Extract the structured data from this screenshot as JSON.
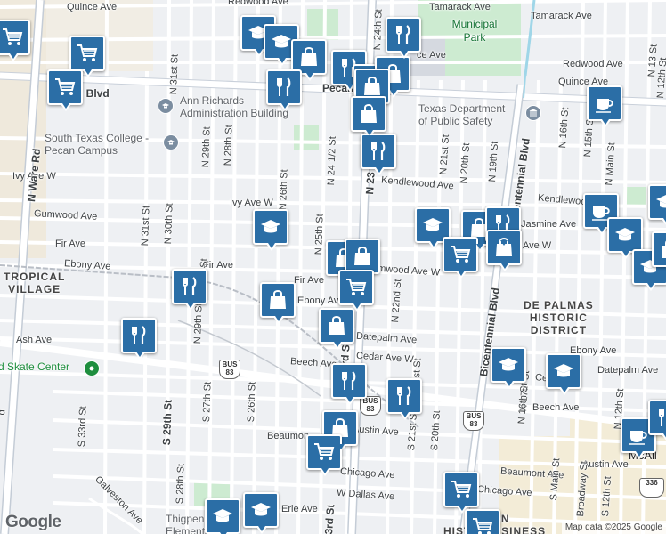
{
  "map": {
    "attribution": "Map data ©2025 Google",
    "logo": "Google",
    "parks": [
      {
        "name": "Municipal\nPark",
        "label": "Municipal Park"
      }
    ],
    "pois": [
      {
        "name": "Ann Richards Administration Building",
        "line1": "Ann Richards",
        "line2": "Administration Building",
        "icon": "school-icon"
      },
      {
        "name": "South Texas College - Pecan Campus",
        "line1": "South Texas College -",
        "line2": "Pecan Campus",
        "icon": "school-icon"
      },
      {
        "name": "Texas Department of Public Safety",
        "line1": "Texas Department",
        "line2": "of Public Safety",
        "icon": "government-icon"
      },
      {
        "name": "Skate Center",
        "line1": "d Skate Center",
        "line2": "",
        "icon": "park-icon"
      },
      {
        "name": "Thigpen Elementary",
        "line1": "Thigpen",
        "line2": "Elementary",
        "icon": "school-icon"
      }
    ],
    "districts": [
      {
        "line1": "TROPICAL",
        "line2": "VILLAGE"
      },
      {
        "line1": "DE PALMAS",
        "line2": "HISTORIC",
        "line3": "DISTRICT"
      },
      {
        "line1": "M   EN",
        "line2": "HISTO   BUSINESS"
      }
    ],
    "city_label": "McAll",
    "streets": {
      "quince_ave": "Quince Ave",
      "redwood_ave": "Redwood Ave",
      "tamarack_ave": "Tamarack Ave",
      "tamarack_ave_e": "Tamarack Ave",
      "redwood_ave_e": "Redwood Ave",
      "quince_ave_e": "Quince Ave",
      "pecan_blvd": "Pecan",
      "pecan_blvd_w": "n Blvd",
      "ivy_ave_w": "Ivy Ave W",
      "kendlewood_ave": "Kendlewood Ave",
      "kendlewood_ave_e": "Kendlewood Ave",
      "gumwood_ave": "Gumwood Ave",
      "jasmine_ave": "Jasmine Ave",
      "fir_ave": "Fir Ave",
      "fir_ave_2": "Fir Ave",
      "fir_ave_3": "Fir Ave",
      "ebony_ave": "Ebony Ave",
      "ebony_ave_2": "Ebony Av",
      "ebony_ave_e": "Ebony Ave",
      "gamwood_ave_w": "amwood Ave W",
      "ave_w": "Ave W",
      "ash_ave": "Ash Ave",
      "datepalm_ave": "Datepalm Ave",
      "datepalm_ave_e": "Datepalm Ave",
      "cedar_ave_w": "Cedar Ave W",
      "cedar_ave_e": "Ce    Ave W",
      "beech_ave": "Beech Ave",
      "beech_ave_e": "Beech Ave",
      "austin_ave": "Austin Ave",
      "austin_ave_e": "Austin Ave",
      "beaumont_ave": "Beaumont Ave",
      "beaumont_ave_w": "Beaumon",
      "chicago_ave": "Chicago Ave",
      "chicago_ave_e": "Chicago Ave",
      "w_dallas_ave": "W Dallas Ave",
      "erie_ave": "Erie Ave",
      "galveston_ave": "Galveston Ave",
      "n_ware_rd": "N Ware Rd",
      "n_31st_st": "N 31st St",
      "n_31st_st_2": "N 31st St",
      "n_30th_st": "N 30th St",
      "n_29th_st": "N 29th St",
      "n_28th_st": "N 28th St",
      "n_28th_st_2": "N 28th St",
      "n_29th_st_2": "N 29th St",
      "n_26th_st": "N 26th St",
      "n_25th_st": "N 25th St",
      "n_24_half_st": "N 24 1/2 St",
      "n_24th_st": "N 24th St",
      "n_23rd_st": "N 23",
      "n_22nd_st": "N 22nd St",
      "n_21st_st": "N 21st St",
      "n_20th_st": "N 20th St",
      "n_19th_st": "N 19th St",
      "n_17th_st": "N 17th St",
      "n_16th_st": "N 16th St",
      "n_16th_st_2": "N 16th St",
      "n_15th_st": "N 15th St",
      "n_13th_st": "N 13 St",
      "n_12th_st": "N 12th St",
      "n_12th_st_2": "N 12th St",
      "n_main_st": "N Main St",
      "bicentennial_blvd": "Bicentennial Blvd",
      "bicentennial_blvd_2": "Bicentennial Blvd",
      "s_29th_st": "S 29th St",
      "s_28th_st": "S 28th St",
      "s_27th_st": "S 27th St",
      "s_26th_st": "S 26th St",
      "s_33rd_st": "S 33rd St",
      "s_21st_st": "S 21st St",
      "s_20th_st": "S 20th St",
      "s_12th_st": "S 12th St",
      "s_main_st": "S Main St",
      "broadway_st": "Broadway St",
      "rd_st": "rd St",
      "rd_st_2": "3rd St",
      "rd_st_3": "3rd St",
      "st_22": "st St",
      "n_23rd_st_b": "N 23rd St"
    },
    "shields": [
      {
        "top": "BUS",
        "num": "83"
      },
      {
        "top": "BUS",
        "num": "83"
      },
      {
        "top": "BUS",
        "num": "83"
      },
      {
        "top": "",
        "num": "83"
      },
      {
        "top": "",
        "num": "336"
      }
    ],
    "markers": [
      {
        "type": "shopping-cart"
      },
      {
        "type": "shopping-cart"
      },
      {
        "type": "shopping-cart"
      },
      {
        "type": "school"
      },
      {
        "type": "school"
      },
      {
        "type": "shopping-bag"
      },
      {
        "type": "restaurant"
      },
      {
        "type": "restaurant"
      },
      {
        "type": "restaurant"
      },
      {
        "type": "shopping-bag"
      },
      {
        "type": "restaurant"
      },
      {
        "type": "shopping-bag"
      },
      {
        "type": "shopping-bag"
      },
      {
        "type": "restaurant"
      },
      {
        "type": "cafe"
      },
      {
        "type": "school"
      },
      {
        "type": "school"
      },
      {
        "type": "shopping-bag"
      },
      {
        "type": "restaurant"
      },
      {
        "type": "cafe"
      },
      {
        "type": "school"
      },
      {
        "type": "school"
      },
      {
        "type": "shopping-bag"
      },
      {
        "type": "shopping-bag"
      },
      {
        "type": "shopping-cart"
      },
      {
        "type": "shopping-bag"
      },
      {
        "type": "school"
      },
      {
        "type": "restaurant"
      },
      {
        "type": "shopping-bag"
      },
      {
        "type": "shopping-cart"
      },
      {
        "type": "shopping-bag"
      },
      {
        "type": "restaurant"
      },
      {
        "type": "shopping-bag"
      },
      {
        "type": "restaurant"
      },
      {
        "type": "restaurant"
      },
      {
        "type": "shopping-bag"
      },
      {
        "type": "shopping-cart"
      },
      {
        "type": "school"
      },
      {
        "type": "school"
      },
      {
        "type": "cafe"
      },
      {
        "type": "restaurant"
      },
      {
        "type": "shopping-cart"
      },
      {
        "type": "shopping-cart"
      },
      {
        "type": "school"
      },
      {
        "type": "school"
      }
    ],
    "colors": {
      "marker": "#2b6ea6",
      "park": "#c8e6c9",
      "road": "#ffffff",
      "highway": "#c4ccd6",
      "railway": "#b9bec6",
      "water": "#9fd6e8"
    }
  }
}
